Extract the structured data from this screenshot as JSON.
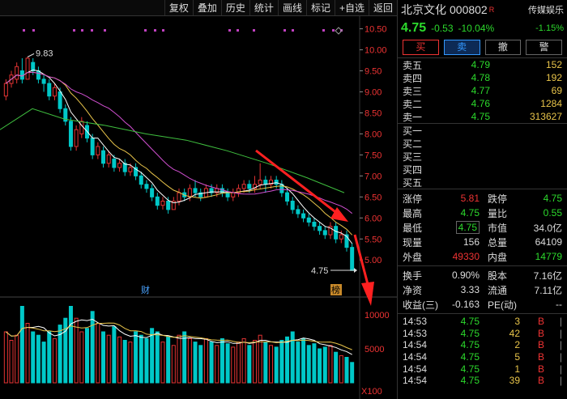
{
  "toolbar": {
    "buttons": [
      "复权",
      "叠加",
      "历史",
      "统计",
      "画线",
      "标记",
      "+自选",
      "返回"
    ]
  },
  "chart": {
    "price_axis": [
      "10.50",
      "10.00",
      "9.50",
      "9.00",
      "8.50",
      "8.00",
      "7.50",
      "7.00",
      "6.50",
      "6.00",
      "5.50",
      "5.00"
    ],
    "volume_axis": [
      "10000",
      "5000"
    ],
    "volume_unit": "X100",
    "high_label": "9.83",
    "last_label": "4.75",
    "event_label": "财",
    "rank_label": "榜",
    "colors": {
      "up": "#e33333",
      "down": "#00c8c8",
      "ma_short": "#ffffff",
      "ma_mid": "#e8c44a",
      "ma_long": "#d04fd0",
      "ma_longest": "#3fbf3f",
      "arrow": "#ff2020"
    }
  },
  "chart_data": {
    "type": "candlestick",
    "y_range": [
      4.6,
      10.8
    ],
    "candles": [
      [
        8.9,
        9.2,
        8.8,
        9.3
      ],
      [
        9.2,
        9.4,
        9.1,
        9.5
      ],
      [
        9.3,
        9.6,
        9.2,
        9.7
      ],
      [
        9.5,
        9.3,
        9.2,
        9.8
      ],
      [
        9.3,
        9.8,
        9.3,
        9.83
      ],
      [
        9.7,
        9.5,
        9.4,
        9.8
      ],
      [
        9.5,
        9.3,
        9.2,
        9.6
      ],
      [
        9.3,
        9.2,
        9.0,
        9.4
      ],
      [
        9.2,
        8.9,
        8.8,
        9.3
      ],
      [
        8.9,
        9.1,
        8.8,
        9.2
      ],
      [
        9.0,
        8.6,
        8.5,
        9.1
      ],
      [
        8.6,
        8.3,
        8.2,
        8.7
      ],
      [
        8.3,
        7.7,
        7.6,
        8.4
      ],
      [
        7.7,
        8.1,
        7.6,
        8.2
      ],
      [
        8.0,
        8.3,
        7.9,
        8.4
      ],
      [
        8.2,
        7.9,
        7.8,
        8.3
      ],
      [
        7.9,
        7.5,
        7.4,
        8.0
      ],
      [
        7.5,
        7.7,
        7.4,
        7.8
      ],
      [
        7.6,
        7.3,
        7.2,
        7.7
      ],
      [
        7.3,
        7.5,
        7.2,
        7.6
      ],
      [
        7.4,
        7.2,
        7.1,
        7.5
      ],
      [
        7.2,
        7.3,
        7.1,
        7.4
      ],
      [
        7.3,
        7.1,
        7.0,
        7.4
      ],
      [
        7.1,
        7.2,
        7.0,
        7.3
      ],
      [
        7.2,
        7.0,
        6.9,
        7.3
      ],
      [
        7.0,
        6.8,
        6.7,
        7.1
      ],
      [
        6.8,
        6.7,
        6.6,
        6.9
      ],
      [
        6.7,
        6.5,
        6.4,
        6.8
      ],
      [
        6.5,
        6.3,
        6.2,
        6.6
      ],
      [
        6.3,
        6.4,
        6.2,
        6.5
      ],
      [
        6.4,
        6.2,
        6.1,
        6.5
      ],
      [
        6.2,
        6.4,
        6.2,
        6.5
      ],
      [
        6.4,
        6.6,
        6.3,
        6.7
      ],
      [
        6.6,
        6.5,
        6.4,
        6.7
      ],
      [
        6.5,
        6.7,
        6.4,
        6.8
      ],
      [
        6.7,
        6.6,
        6.5,
        6.9
      ],
      [
        6.6,
        6.5,
        6.4,
        6.7
      ],
      [
        6.5,
        6.7,
        6.5,
        6.8
      ],
      [
        6.7,
        6.6,
        6.5,
        6.8
      ],
      [
        6.6,
        6.7,
        6.5,
        6.8
      ],
      [
        6.7,
        6.6,
        6.5,
        6.8
      ],
      [
        6.6,
        6.5,
        6.4,
        6.7
      ],
      [
        6.5,
        6.6,
        6.4,
        6.7
      ],
      [
        6.6,
        6.7,
        6.5,
        6.8
      ],
      [
        6.7,
        6.8,
        6.6,
        6.9
      ],
      [
        6.8,
        6.7,
        6.6,
        6.9
      ],
      [
        6.7,
        6.8,
        6.6,
        7.0
      ],
      [
        6.8,
        6.9,
        6.7,
        7.3
      ],
      [
        6.9,
        6.8,
        6.6,
        7.0
      ],
      [
        6.8,
        6.9,
        6.7,
        7.0
      ],
      [
        6.9,
        6.8,
        6.7,
        7.0
      ],
      [
        6.8,
        6.6,
        6.5,
        6.9
      ],
      [
        6.6,
        6.4,
        6.3,
        6.7
      ],
      [
        6.4,
        6.2,
        6.1,
        6.5
      ],
      [
        6.2,
        6.1,
        6.0,
        6.3
      ],
      [
        6.1,
        6.0,
        5.9,
        6.2
      ],
      [
        6.0,
        5.9,
        5.8,
        6.1
      ],
      [
        5.9,
        5.8,
        5.7,
        6.0
      ],
      [
        5.8,
        5.7,
        5.6,
        5.9
      ],
      [
        5.7,
        5.6,
        5.5,
        5.8
      ],
      [
        5.6,
        5.8,
        5.5,
        5.9
      ],
      [
        5.8,
        5.5,
        5.4,
        5.9
      ],
      [
        5.5,
        5.6,
        5.4,
        5.7
      ],
      [
        5.6,
        5.3,
        5.2,
        5.7
      ],
      [
        5.3,
        4.75,
        4.75,
        5.4
      ]
    ],
    "volumes": [
      30,
      25,
      28,
      45,
      35,
      30,
      28,
      24,
      30,
      26,
      34,
      38,
      45,
      38,
      30,
      32,
      42,
      35,
      30,
      28,
      33,
      27,
      25,
      24,
      30,
      28,
      26,
      32,
      30,
      24,
      27,
      22,
      28,
      30,
      26,
      24,
      22,
      26,
      24,
      22,
      26,
      23,
      21,
      24,
      26,
      22,
      25,
      28,
      24,
      22,
      21,
      25,
      27,
      30,
      24,
      26,
      22,
      23,
      20,
      21,
      22,
      18,
      16,
      15,
      12
    ]
  },
  "quote": {
    "name": "北京文化",
    "code": "000802",
    "badge": "R",
    "sector": "传媒娱乐",
    "sector_pct": "-1.15%",
    "price": "4.75",
    "change": "-0.53",
    "change_pct": "-10.04%"
  },
  "actions": {
    "buy": "买",
    "sell": "卖",
    "cancel": "撤",
    "alert": "警"
  },
  "asks": [
    {
      "label": "卖五",
      "price": "4.79",
      "vol": "152"
    },
    {
      "label": "卖四",
      "price": "4.78",
      "vol": "192"
    },
    {
      "label": "卖三",
      "price": "4.77",
      "vol": "69"
    },
    {
      "label": "卖二",
      "price": "4.76",
      "vol": "1284"
    },
    {
      "label": "卖一",
      "price": "4.75",
      "vol": "313627"
    }
  ],
  "bids": [
    {
      "label": "买一",
      "price": "",
      "vol": ""
    },
    {
      "label": "买二",
      "price": "",
      "vol": ""
    },
    {
      "label": "买三",
      "price": "",
      "vol": ""
    },
    {
      "label": "买四",
      "price": "",
      "vol": ""
    },
    {
      "label": "买五",
      "price": "",
      "vol": ""
    }
  ],
  "stats": {
    "zhangting": {
      "k": "涨停",
      "v": "5.81"
    },
    "dieting": {
      "k": "跌停",
      "v": "4.75"
    },
    "high": {
      "k": "最高",
      "v": "4.75"
    },
    "liangbi": {
      "k": "量比",
      "v": "0.55"
    },
    "low": {
      "k": "最低",
      "v": "4.75"
    },
    "shizhi": {
      "k": "市值",
      "v": "34.0亿"
    },
    "xianliang": {
      "k": "现量",
      "v": "156"
    },
    "zongliang": {
      "k": "总量",
      "v": "64109"
    },
    "waipan": {
      "k": "外盘",
      "v": "49330"
    },
    "neipan": {
      "k": "内盘",
      "v": "14779"
    }
  },
  "stats2": {
    "huanshou": {
      "k": "换手",
      "v": "0.90%"
    },
    "guben": {
      "k": "股本",
      "v": "7.16亿"
    },
    "jingzi": {
      "k": "净资",
      "v": "3.33"
    },
    "liutong": {
      "k": "流通",
      "v": "7.11亿"
    },
    "shouyi": {
      "k": "收益(三)",
      "v": "-0.163"
    },
    "pe": {
      "k": "PE(动)",
      "v": "--"
    }
  },
  "ticks": [
    {
      "t": "14:53",
      "p": "4.75",
      "q": "3",
      "s": "B"
    },
    {
      "t": "14:53",
      "p": "4.75",
      "q": "42",
      "s": "B"
    },
    {
      "t": "14:54",
      "p": "4.75",
      "q": "2",
      "s": "B"
    },
    {
      "t": "14:54",
      "p": "4.75",
      "q": "5",
      "s": "B"
    },
    {
      "t": "14:54",
      "p": "4.75",
      "q": "1",
      "s": "B"
    },
    {
      "t": "14:54",
      "p": "4.75",
      "q": "39",
      "s": "B"
    }
  ]
}
